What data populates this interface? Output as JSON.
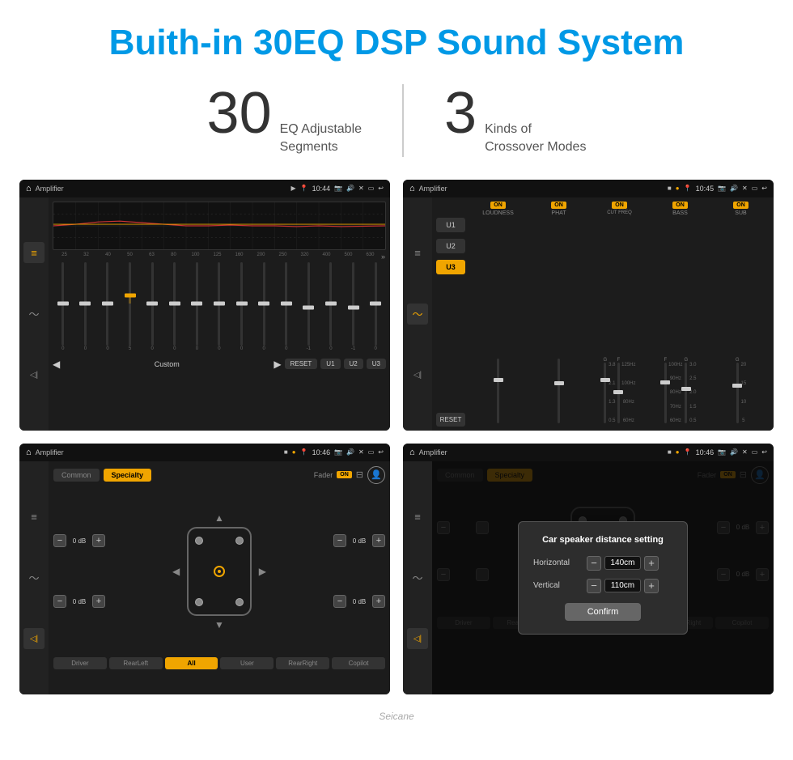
{
  "header": {
    "title": "Buith-in 30EQ DSP Sound System"
  },
  "stats": [
    {
      "number": "30",
      "desc": "EQ Adjustable\nSegments"
    },
    {
      "number": "3",
      "desc": "Kinds of\nCrossover Modes"
    }
  ],
  "screens": [
    {
      "id": "eq-screen",
      "title": "Amplifier",
      "time": "10:44",
      "type": "equalizer",
      "preset": "Custom",
      "freq_labels": [
        "25",
        "32",
        "40",
        "50",
        "63",
        "80",
        "100",
        "125",
        "160",
        "200",
        "250",
        "320",
        "400",
        "500",
        "630"
      ],
      "values": [
        "0",
        "0",
        "0",
        "5",
        "0",
        "0",
        "0",
        "0",
        "0",
        "0",
        "0",
        "-1",
        "0",
        "-1",
        "0"
      ],
      "buttons": [
        "RESET",
        "U1",
        "U2",
        "U3"
      ]
    },
    {
      "id": "crossover-screen",
      "title": "Amplifier",
      "time": "10:45",
      "type": "crossover",
      "presets": [
        "U1",
        "U2",
        "U3"
      ],
      "active_preset": "U3",
      "channels": [
        {
          "name": "LOUDNESS",
          "on": true
        },
        {
          "name": "PHAT",
          "on": true
        },
        {
          "name": "CUT FREQ",
          "on": true
        },
        {
          "name": "BASS",
          "on": true
        },
        {
          "name": "SUB",
          "on": true
        }
      ],
      "reset_label": "RESET"
    },
    {
      "id": "specialty-screen",
      "title": "Amplifier",
      "time": "10:46",
      "type": "specialty",
      "tabs": [
        "Common",
        "Specialty"
      ],
      "active_tab": "Specialty",
      "fader_label": "Fader",
      "fader_on": true,
      "speaker_values": {
        "front_left_db": "0 dB",
        "front_right_db": "0 dB",
        "rear_left_db": "0 dB",
        "rear_right_db": "0 dB"
      },
      "bottom_buttons": [
        "Driver",
        "RearLeft",
        "All",
        "User",
        "RearRight",
        "Copilot"
      ],
      "active_bottom": "All"
    },
    {
      "id": "dialog-screen",
      "title": "Amplifier",
      "time": "10:46",
      "type": "dialog",
      "tabs": [
        "Common",
        "Specialty"
      ],
      "active_tab": "Specialty",
      "fader_on": true,
      "dialog": {
        "title": "Car speaker distance setting",
        "fields": [
          {
            "label": "Horizontal",
            "value": "140cm"
          },
          {
            "label": "Vertical",
            "value": "110cm"
          }
        ],
        "confirm_label": "Confirm"
      },
      "speaker_values": {
        "front_right_db": "0 dB",
        "rear_right_db": "0 dB"
      },
      "bottom_buttons": [
        "Driver",
        "RearLeft",
        "All",
        "User",
        "RearRight",
        "Copilot"
      ]
    }
  ],
  "watermark": "Seicane"
}
